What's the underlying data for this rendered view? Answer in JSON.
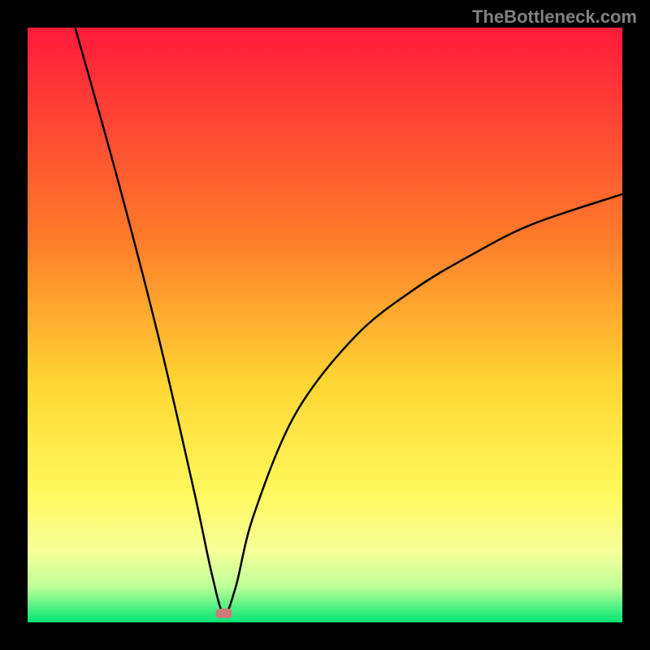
{
  "watermark": "TheBottleneck.com",
  "chart_data": {
    "type": "line",
    "title": "",
    "xlabel": "",
    "ylabel": "",
    "xlim": [
      0,
      100
    ],
    "ylim": [
      0,
      100
    ],
    "background": {
      "type": "gradient",
      "stops": [
        {
          "offset": 0,
          "color": "#ff1a3c"
        },
        {
          "offset": 35,
          "color": "#ff7a2a"
        },
        {
          "offset": 60,
          "color": "#ffd633"
        },
        {
          "offset": 78,
          "color": "#fff95c"
        },
        {
          "offset": 88,
          "color": "#f7ff99"
        },
        {
          "offset": 94,
          "color": "#bfff99"
        },
        {
          "offset": 100,
          "color": "#00e673"
        }
      ]
    },
    "axes_color": "#000000",
    "curve": {
      "description": "V-shaped bottleneck curve with asymmetric branches meeting near the bottom",
      "minimum_x": 33,
      "minimum_y": 1.5,
      "left_start": {
        "x": 8,
        "y": 100
      },
      "right_end": {
        "x": 100,
        "y": 72
      },
      "points": [
        {
          "x": 8,
          "y": 100
        },
        {
          "x": 15,
          "y": 75
        },
        {
          "x": 22,
          "y": 48
        },
        {
          "x": 28,
          "y": 22
        },
        {
          "x": 31,
          "y": 8
        },
        {
          "x": 33,
          "y": 1.5
        },
        {
          "x": 35,
          "y": 6
        },
        {
          "x": 38,
          "y": 18
        },
        {
          "x": 45,
          "y": 35
        },
        {
          "x": 55,
          "y": 48
        },
        {
          "x": 65,
          "y": 56
        },
        {
          "x": 75,
          "y": 62
        },
        {
          "x": 85,
          "y": 67
        },
        {
          "x": 100,
          "y": 72
        }
      ]
    },
    "marker": {
      "x": 33,
      "y": 1.5,
      "color": "#cc7a7a",
      "shape": "rounded-rect"
    }
  }
}
